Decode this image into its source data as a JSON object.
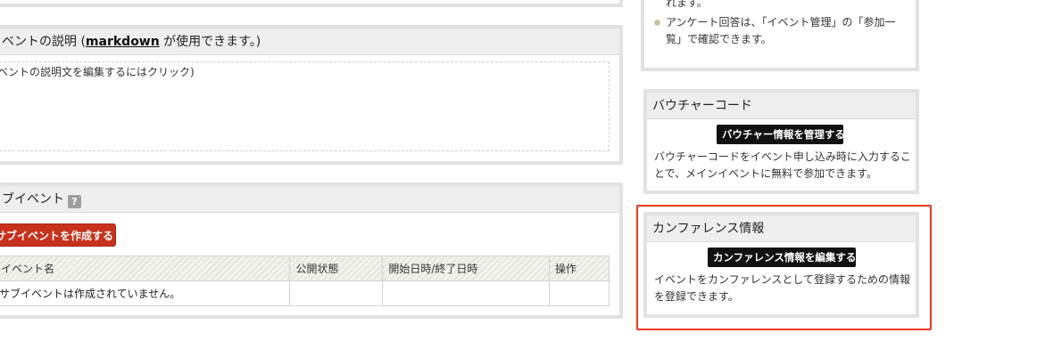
{
  "description": {
    "header_prefix": "ベントの説明 (",
    "header_link": "markdown",
    "header_suffix": " が使用できます。)",
    "editor_placeholder": "ベントの説明文を編集するにはクリック)"
  },
  "subevents": {
    "title": "ブイベント",
    "help_icon": "?",
    "create_button": "サブイベントを作成する",
    "columns": [
      "イベント名",
      "公開状態",
      "開始日時/終了日時",
      "操作"
    ],
    "empty_row": [
      "サブイベントは作成されていません。",
      "",
      "",
      ""
    ]
  },
  "survey": {
    "note_tail": "れます。",
    "items": [
      "アンケート回答は、「イベント管理」の「参加一覧」で確認できます。"
    ]
  },
  "voucher": {
    "title": "バウチャーコード",
    "button": "バウチャー情報を管理する",
    "description": "バウチャーコードをイベント申し込み時に入力することで、メインイベントに無料で参加できます。"
  },
  "conference": {
    "title": "カンファレンス情報",
    "button": "カンファレンス情報を編集する",
    "description": "イベントをカンファレンスとして登録するための情報を登録できます。"
  },
  "colors": {
    "highlight": "#ea3b22",
    "create_button_bg": "#c8321c",
    "black_button_bg": "#111111"
  }
}
